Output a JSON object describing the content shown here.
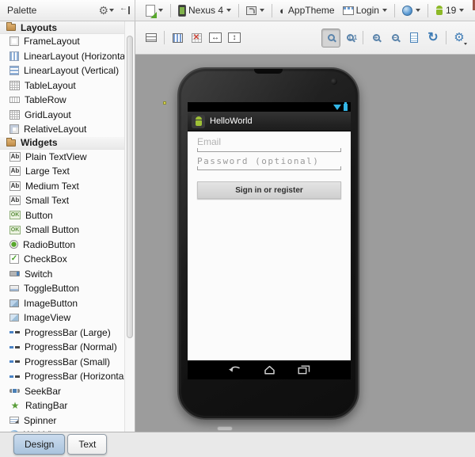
{
  "colors": {
    "accent_blue": "#33b5e5",
    "android_green": "#9fc136",
    "canvas_gray": "#9c9c9c",
    "selected_tab_blue": "#a9c4dd",
    "marker_yellow": "#d9d955"
  },
  "palette": {
    "title": "Palette",
    "sections": [
      {
        "label": "Layouts",
        "items": [
          {
            "label": "FrameLayout",
            "icon": "frame-layout"
          },
          {
            "label": "LinearLayout (Horizontal)",
            "icon": "linear-horizontal"
          },
          {
            "label": "LinearLayout (Vertical)",
            "icon": "linear-vertical"
          },
          {
            "label": "TableLayout",
            "icon": "table-layout"
          },
          {
            "label": "TableRow",
            "icon": "table-row"
          },
          {
            "label": "GridLayout",
            "icon": "grid-layout"
          },
          {
            "label": "RelativeLayout",
            "icon": "relative-layout"
          }
        ]
      },
      {
        "label": "Widgets",
        "items": [
          {
            "label": "Plain TextView",
            "icon": "textview"
          },
          {
            "label": "Large Text",
            "icon": "textview"
          },
          {
            "label": "Medium Text",
            "icon": "textview"
          },
          {
            "label": "Small Text",
            "icon": "textview"
          },
          {
            "label": "Button",
            "icon": "button"
          },
          {
            "label": "Small Button",
            "icon": "button"
          },
          {
            "label": "RadioButton",
            "icon": "radio"
          },
          {
            "label": "CheckBox",
            "icon": "checkbox"
          },
          {
            "label": "Switch",
            "icon": "switch"
          },
          {
            "label": "ToggleButton",
            "icon": "toggle"
          },
          {
            "label": "ImageButton",
            "icon": "image-button"
          },
          {
            "label": "ImageView",
            "icon": "image-view"
          },
          {
            "label": "ProgressBar (Large)",
            "icon": "progress"
          },
          {
            "label": "ProgressBar (Normal)",
            "icon": "progress"
          },
          {
            "label": "ProgressBar (Small)",
            "icon": "progress"
          },
          {
            "label": "ProgressBar (Horizontal)",
            "icon": "progress"
          },
          {
            "label": "SeekBar",
            "icon": "seekbar"
          },
          {
            "label": "RatingBar",
            "icon": "rating"
          },
          {
            "label": "Spinner",
            "icon": "spinner"
          },
          {
            "label": "WebView",
            "icon": "webview"
          }
        ]
      }
    ]
  },
  "toolbar": {
    "device": "Nexus 4",
    "theme": "AppTheme",
    "activity": "Login",
    "api_level": "19"
  },
  "preview": {
    "app_title": "HelloWorld",
    "email_hint": "Email",
    "password_hint": "Password (optional)",
    "signin_button": "Sign in or register"
  },
  "tabs": [
    {
      "label": "Design",
      "active": true
    },
    {
      "label": "Text",
      "active": false
    }
  ],
  "icon_glyphs": {
    "checkbox": "✓",
    "textview": "Ab",
    "button": "OK",
    "rating": "★"
  }
}
